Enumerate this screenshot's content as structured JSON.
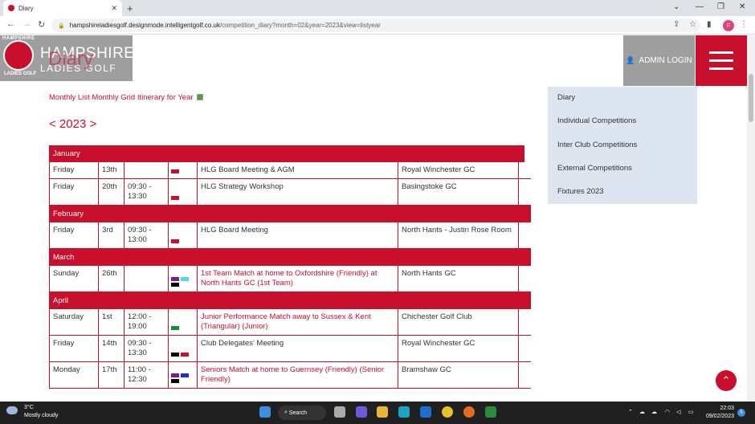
{
  "browser": {
    "tab_title": "Diary",
    "new_tab": "+",
    "url_host": "hampshireladiesgolf.designmode.intelligentgolf.co.uk",
    "url_path": "/competition_diary?month=02&year=2023&view=listyear",
    "profile_initial": "F"
  },
  "site": {
    "brand_line1": "HAMPSHIRE",
    "brand_line2": "LADIES GOLF",
    "crest_top": "HAMPSHIRE",
    "crest_bottom": "LADIES GOLF",
    "page_title": "Diary",
    "admin_login": "ADMIN LOGIN",
    "view_links": "Monthly List Monthly Grid Itinerary for Year",
    "year_nav": "< 2023 >"
  },
  "sidebar": {
    "items": [
      {
        "label": "Diary"
      },
      {
        "label": "Individual Competitions"
      },
      {
        "label": "Inter Club Competitions"
      },
      {
        "label": "External Competitions"
      },
      {
        "label": "Fixtures 2023"
      }
    ]
  },
  "colors": {
    "brand_red": "#c8102e",
    "purple": "#7b1c8c",
    "cyan": "#4dd9e8",
    "black": "#000000",
    "green": "#1a8a2a",
    "blue": "#1c2fd6"
  },
  "diary": {
    "months": [
      {
        "name": "January",
        "events": [
          {
            "day": "Friday",
            "date": "13th",
            "time": "",
            "swatches": [
              "brand_red"
            ],
            "title": "HLG Board Meeting & AGM",
            "is_link": false,
            "venue": "Royal Winchester GC"
          },
          {
            "day": "Friday",
            "date": "20th",
            "time": "09:30 - 13:30",
            "swatches": [
              "brand_red"
            ],
            "title": "HLG Strategy Workshop",
            "is_link": false,
            "venue": "Basingstoke GC"
          }
        ]
      },
      {
        "name": "February",
        "events": [
          {
            "day": "Friday",
            "date": "3rd",
            "time": "09:30 - 13:00",
            "swatches": [
              "brand_red"
            ],
            "title": "HLG Board Meeting",
            "is_link": false,
            "venue": "North Hants - Justin Rose Room"
          }
        ]
      },
      {
        "name": "March",
        "events": [
          {
            "day": "Sunday",
            "date": "26th",
            "time": "",
            "swatches": [
              "purple",
              "cyan",
              "black"
            ],
            "title": "1st Team Match at home to Oxfordshire (Friendly) at North Hants GC (1st Team)",
            "is_link": true,
            "venue": "North Hants GC"
          }
        ]
      },
      {
        "name": "April",
        "events": [
          {
            "day": "Saturday",
            "date": "1st",
            "time": "12:00 - 19:00",
            "swatches": [
              "green"
            ],
            "title": "Junior Performance Match away to Sussex & Kent (Triangular) (Junior)",
            "is_link": true,
            "venue": "Chichester Golf Club"
          },
          {
            "day": "Friday",
            "date": "14th",
            "time": "09:30 - 13:30",
            "swatches": [
              "black",
              "brand_red"
            ],
            "title": "Club Delegates' Meeting",
            "is_link": false,
            "venue": "Royal Winchester GC"
          },
          {
            "day": "Monday",
            "date": "17th",
            "time": "11:00 - 12:30",
            "swatches": [
              "purple",
              "blue",
              "black"
            ],
            "title": "Seniors Match at home to Guernsey (Friendly) (Senior Friendly)",
            "is_link": true,
            "venue": "Bramshaw GC"
          }
        ]
      }
    ]
  },
  "taskbar": {
    "temp": "3°C",
    "weather": "Mostly cloudy",
    "search": "Search",
    "time": "22:03",
    "date": "09/02/2023",
    "notifications": "5"
  }
}
